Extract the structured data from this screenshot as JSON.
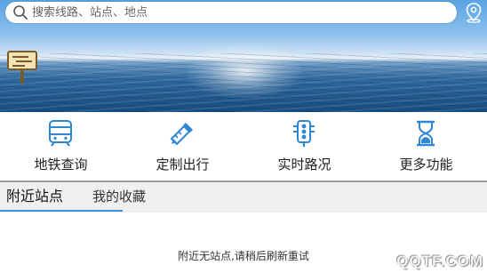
{
  "search": {
    "placeholder": "搜索线路、站点、地点",
    "search_icon": "search-icon",
    "location_icon": "location-pin-icon"
  },
  "banner": {
    "icon": "signboard-icon"
  },
  "quick_actions": [
    {
      "label": "地铁查询",
      "icon": "train-icon"
    },
    {
      "label": "定制出行",
      "icon": "pencil-ruler-icon"
    },
    {
      "label": "实时路况",
      "icon": "traffic-light-icon"
    },
    {
      "label": "更多功能",
      "icon": "hourglass-icon"
    }
  ],
  "tabs": {
    "nearby_label": "附近站点",
    "favorites_label": "我的收藏",
    "active": "nearby"
  },
  "content": {
    "empty_message": "附近无站点,请稍后刷新重试"
  },
  "watermark": "QQTF.COM",
  "colors": {
    "accent": "#3d8fd6",
    "icon_blue": "#2e86d6",
    "tab_bg": "#f0f0f0"
  }
}
